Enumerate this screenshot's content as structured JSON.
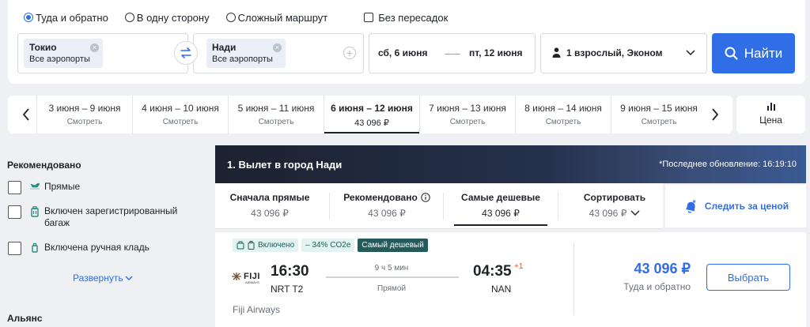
{
  "search": {
    "trip_types": [
      {
        "label": "Туда и обратно",
        "selected": true
      },
      {
        "label": "В одну сторону",
        "selected": false
      },
      {
        "label": "Сложный маршрут",
        "selected": false
      }
    ],
    "direct_only_label": "Без пересадок",
    "origin": {
      "city": "Токио",
      "airports": "Все аэропорты"
    },
    "destination": {
      "city": "Нади",
      "airports": "Все аэропорты"
    },
    "depart_date": "сб, 6 июня",
    "return_date": "пт, 12 июня",
    "passengers": "1 взрослый, Эконом",
    "search_button": "Найти",
    "accent_color": "#2f6ee6"
  },
  "date_strip": {
    "tabs": [
      {
        "range": "3 июня – 9 июня",
        "value": "Смотреть",
        "active": false
      },
      {
        "range": "4 июня – 10 июня",
        "value": "Смотреть",
        "active": false
      },
      {
        "range": "5 июня – 11 июня",
        "value": "Смотреть",
        "active": false
      },
      {
        "range": "6 июня – 12 июня",
        "value": "43 096 ₽",
        "active": true
      },
      {
        "range": "7 июня – 13 июня",
        "value": "Смотреть",
        "active": false
      },
      {
        "range": "8 июня – 14 июня",
        "value": "Смотреть",
        "active": false
      },
      {
        "range": "9 июня – 15 июня",
        "value": "Смотреть",
        "active": false
      }
    ],
    "price_chart_label": "Цена"
  },
  "sidebar": {
    "recommended_title": "Рекомендовано",
    "filters": [
      {
        "label": "Прямые",
        "icon": "direct-flight-icon"
      },
      {
        "label": "Включен зарегистрированный багаж",
        "icon": "checked-baggage-icon"
      },
      {
        "label": "Включена ручная кладь",
        "icon": "carry-on-icon"
      }
    ],
    "expand_label": "Развернуть",
    "alliance_title": "Альянс"
  },
  "results": {
    "header_title": "1. Вылет в город Нади",
    "last_updated": "*Последнее обновление: 16:19:10",
    "sort_tabs": [
      {
        "title": "Сначала прямые",
        "value": "43 096 ₽",
        "active": false
      },
      {
        "title": "Рекомендовано",
        "value": "43 096 ₽",
        "active": false
      },
      {
        "title": "Самые дешевые",
        "value": "43 096 ₽",
        "active": true
      },
      {
        "title": "Сортировать",
        "value": "43 096 ₽",
        "active": false
      }
    ],
    "track_price_label": "Следить за ценой",
    "flight": {
      "badges": {
        "included": "Включено",
        "co2": "– 34% CO2e",
        "cheapest": "Самый дешевый"
      },
      "airline_logo_text": "FIJI",
      "airline_logo_sub": "AIRWAYS",
      "airline": "Fiji Airways",
      "depart_time": "16:30",
      "depart_airport": "NRT T2",
      "arrive_time": "04:35",
      "arrive_day_offset": "+1",
      "arrive_airport": "NAN",
      "duration": "9 ч 5 мин",
      "stops": "Прямой",
      "price": "43 096 ₽",
      "price_note": "Туда и обратно",
      "select_label": "Выбрать"
    }
  }
}
